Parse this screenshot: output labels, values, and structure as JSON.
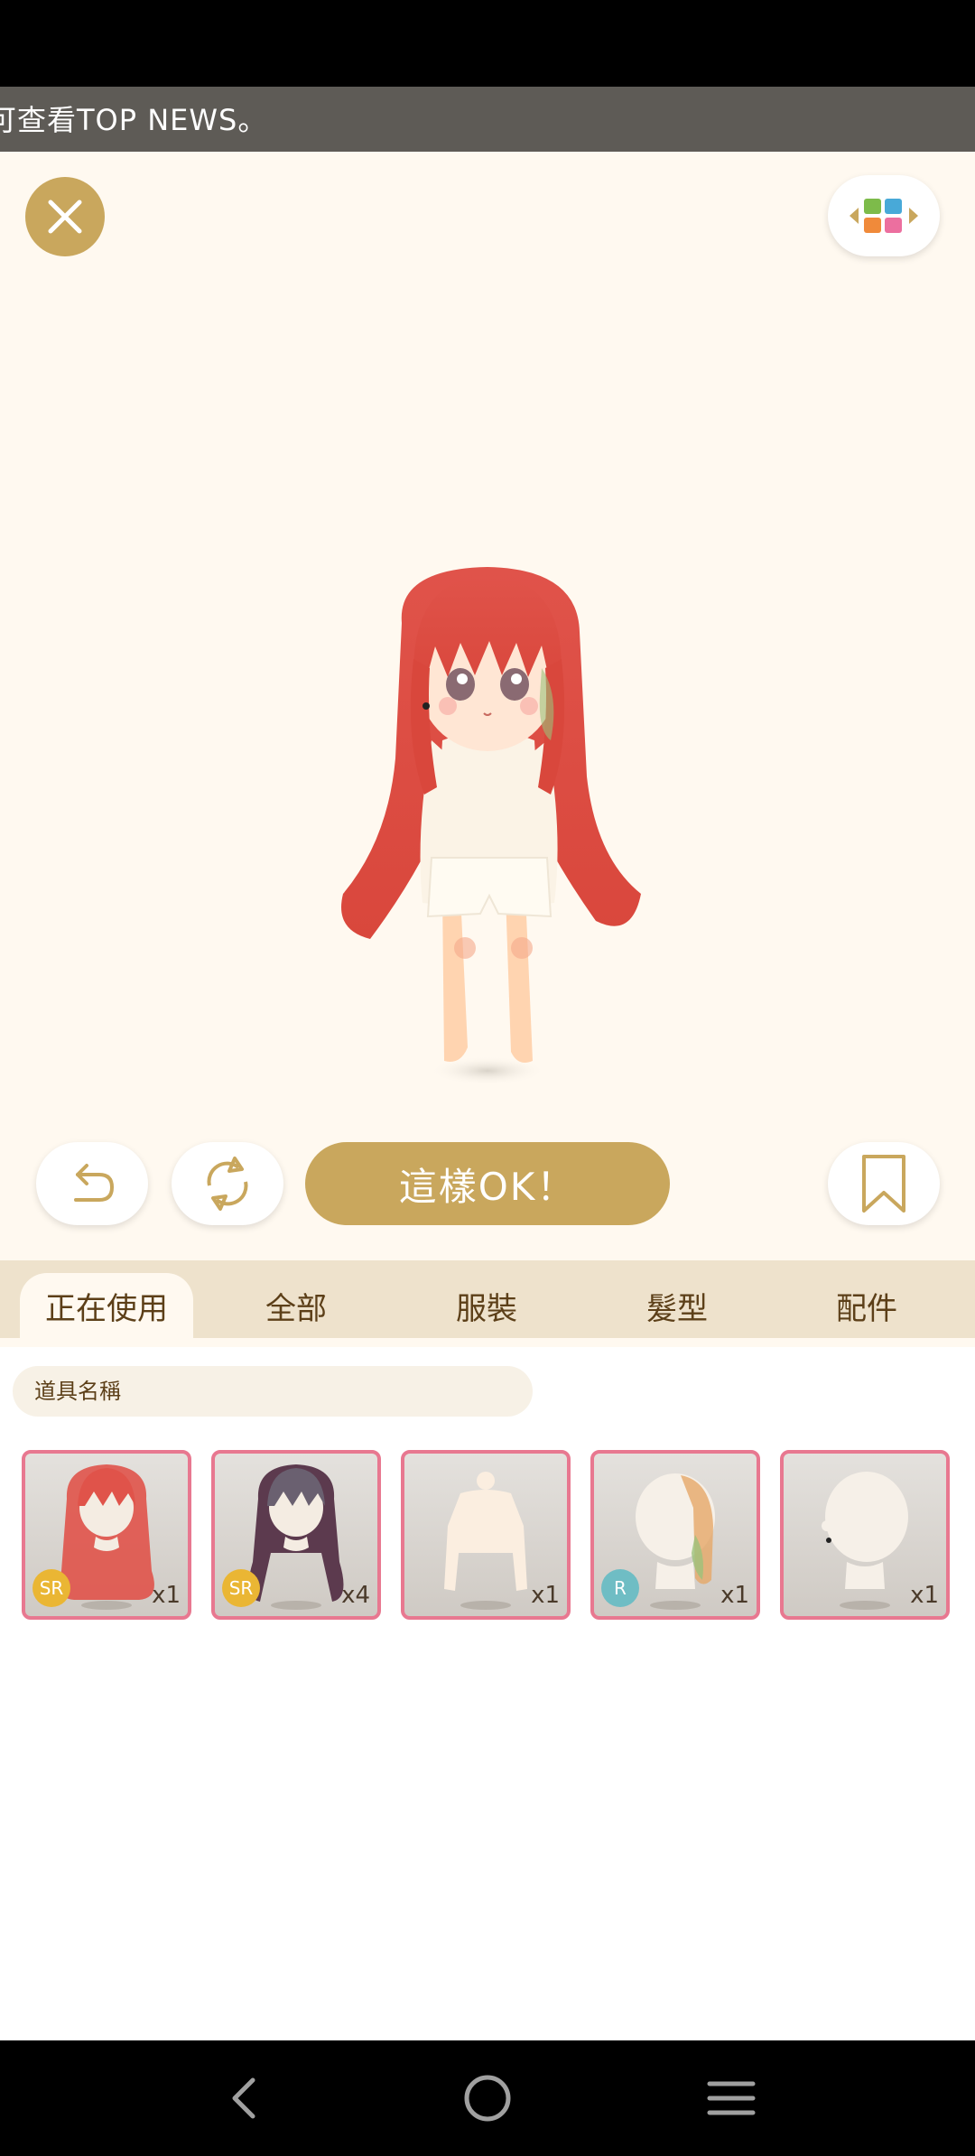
{
  "ticker": {
    "text": "可查看TOP NEWS。"
  },
  "icons": {
    "close": "close-icon",
    "grid": "grid-switch-icon",
    "undo": "undo-icon",
    "rotate": "rotate-icon",
    "bookmark": "bookmark-icon",
    "nav_back": "back-icon",
    "nav_home": "home-icon",
    "nav_menu": "menu-icon"
  },
  "actions": {
    "ok_label": "這樣OK！"
  },
  "tabs": [
    {
      "label": "正在使用",
      "active": true
    },
    {
      "label": "全部"
    },
    {
      "label": "服裝"
    },
    {
      "label": "髮型"
    },
    {
      "label": "配件"
    }
  ],
  "search": {
    "placeholder": "道具名稱"
  },
  "items": [
    {
      "name": "red-long-hair",
      "rarity": "SR",
      "qty": "x1"
    },
    {
      "name": "dark-purple-long-hair",
      "rarity": "SR",
      "qty": "x4"
    },
    {
      "name": "cream-sweater",
      "rarity": "",
      "qty": "x1"
    },
    {
      "name": "gradient-hair-accessory",
      "rarity": "R",
      "qty": "x1"
    },
    {
      "name": "earring-accessory",
      "rarity": "",
      "qty": "x1"
    }
  ],
  "colors": {
    "accent": "#c9a75d",
    "item_border": "#e87890",
    "tab_bar": "#eee2cc",
    "text_brown": "#5c3f18"
  }
}
